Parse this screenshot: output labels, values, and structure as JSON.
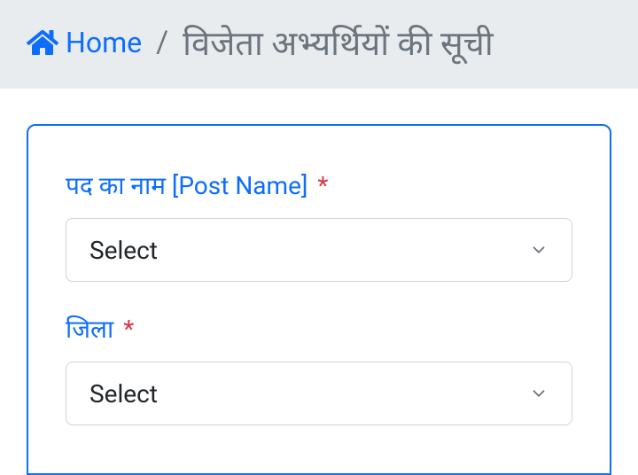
{
  "breadcrumb": {
    "home_label": "Home",
    "separator": "/",
    "page_title": "विजेता अभ्यर्थियों की सूची"
  },
  "form": {
    "fields": [
      {
        "label": "पद का नाम [Post Name]",
        "required": "*",
        "value": "Select"
      },
      {
        "label": "जिला ",
        "required": "*",
        "value": "Select"
      }
    ]
  }
}
